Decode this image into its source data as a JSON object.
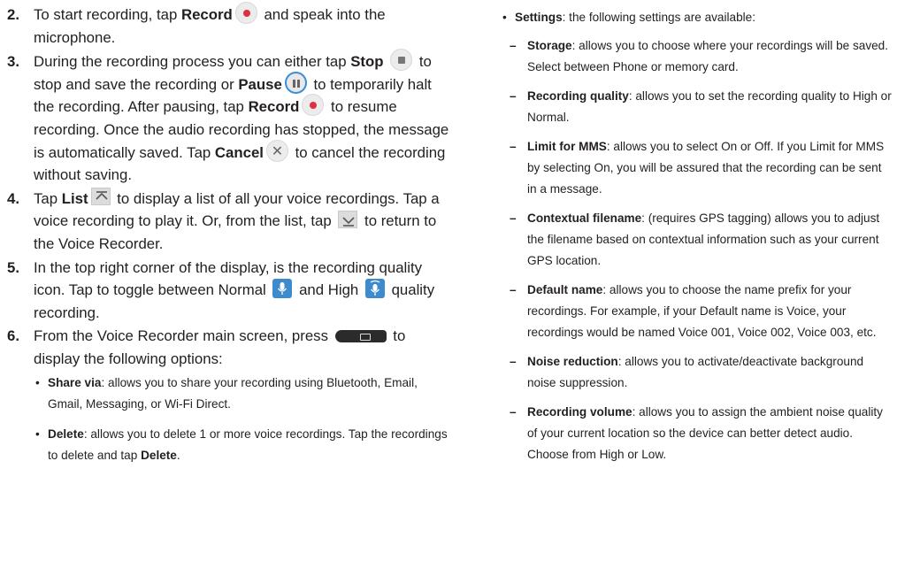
{
  "left": {
    "steps": [
      {
        "num": "2.",
        "t1": "To start recording, tap ",
        "b1": "Record",
        "t2": " and speak into the microphone."
      },
      {
        "num": "3.",
        "t1": "During the recording process you can either tap ",
        "b1": "Stop",
        "t2": " to stop and save the recording or ",
        "b2": "Pause",
        "t3": " to temporarily halt the recording. After pausing, tap ",
        "b3": "Record",
        "t4": " to resume recording. Once the audio recording has stopped, the message is automatically saved. Tap ",
        "b4": "Cancel",
        "t5": " to cancel the recording without saving."
      },
      {
        "num": "4.",
        "t1": "Tap ",
        "b1": "List",
        "t2": " to display a list of all your voice recordings. Tap a voice recording to play it. Or, from the list, tap ",
        "t3": " to return to the Voice Recorder."
      },
      {
        "num": "5.",
        "t1": "In the top right corner of the display, is the recording quality icon. Tap to toggle between Normal ",
        "t2": " and High ",
        "t3": " quality recording."
      },
      {
        "num": "6.",
        "t1": "From the Voice Recorder main screen, press ",
        "t2": " to display the following options:"
      }
    ],
    "options": [
      {
        "name": "Share via",
        "desc": ": allows you to share your recording using Bluetooth, Email, Gmail, Messaging, or Wi-Fi Direct."
      },
      {
        "name": "Delete",
        "desc": ": allows you to delete 1 or more voice recordings. Tap the recordings to delete and tap ",
        "name2": "Delete",
        "end": "."
      }
    ]
  },
  "right": {
    "settings_name": "Settings",
    "settings_desc": ": the following settings are available:",
    "subitems": [
      {
        "name": "Storage",
        "desc": ": allows you to choose where your recordings will be saved. Select between Phone or memory card."
      },
      {
        "name": "Recording quality",
        "desc": ": allows you to set the recording quality to High or Normal."
      },
      {
        "name": "Limit for MMS",
        "desc": ": allows you to select On or Off. If you Limit for MMS by selecting On, you will be assured that the recording can be sent in a message."
      },
      {
        "name": "Contextual filename",
        "desc": ": (requires GPS tagging) allows you to adjust the filename based on contextual information such as your current GPS location."
      },
      {
        "name": "Default name",
        "desc": ": allows you to choose the name prefix for your recordings. For example, if your Default name is Voice, your recordings would be named Voice 001, Voice 002, Voice 003, etc."
      },
      {
        "name": "Noise reduction",
        "desc": ": allows you to activate/deactivate background noise suppression."
      },
      {
        "name": "Recording volume",
        "desc": ": allows you to assign the ambient noise quality of your current location so the device can better detect audio. Choose from High or Low."
      }
    ]
  },
  "icons": {
    "record": "record-icon",
    "stop": "stop-icon",
    "pause": "pause-icon",
    "cancel": "cancel-icon",
    "list": "list-icon",
    "back": "return-icon",
    "normal_quality": "normal-quality-mic-icon",
    "high_quality": "high-quality-mic-icon",
    "menu_key": "menu-key-icon"
  }
}
